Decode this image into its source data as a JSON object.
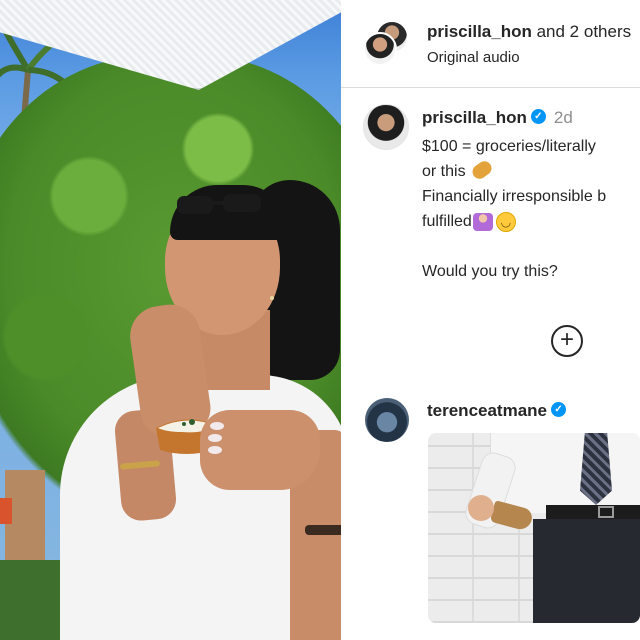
{
  "header": {
    "username": "priscilla_hon",
    "others_text": " and 2 others",
    "audio": "Original audio"
  },
  "caption": {
    "username": "priscilla_hon",
    "time": "2d",
    "lines": [
      "$100 = groceries/literally",
      "or this",
      "Financially irresponsible b",
      "fulfilled",
      "",
      "Would you try this?"
    ]
  },
  "load_more": {
    "label": "+"
  },
  "comment": {
    "username": "terenceatmane"
  },
  "icons": {
    "verified": "verified-badge-icon",
    "load_more": "plus-circle-icon"
  },
  "colors": {
    "verified": "#0095f6",
    "text": "#262626",
    "muted": "#8e8e8e",
    "divider": "#dbdbdb"
  }
}
